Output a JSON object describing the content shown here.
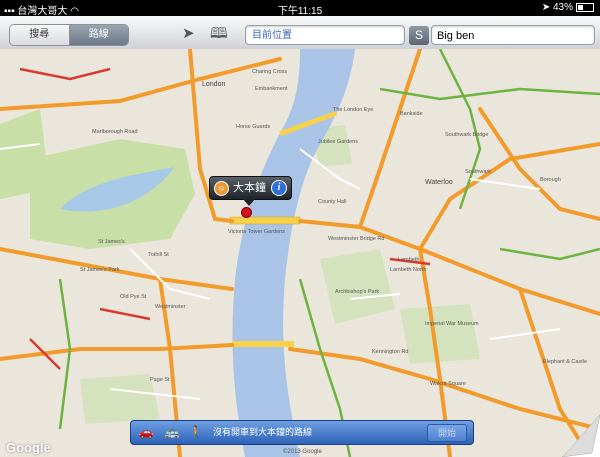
{
  "status_bar": {
    "carrier": "台灣大哥大",
    "time": "下午11:15",
    "battery": "43%"
  },
  "toolbar": {
    "segments": [
      "搜尋",
      "路線"
    ],
    "location_icon": "location-arrow-icon",
    "bookmarks_icon": "bookmarks-icon",
    "start_field": "目前位置",
    "swap_label": "S",
    "end_field": "Big ben"
  },
  "map": {
    "labels": [
      "London",
      "Embankment",
      "Charing Cross",
      "Horse Guards",
      "The London Eye",
      "County Hall",
      "Waterloo",
      "Westminster",
      "St James's",
      "Tothill St",
      "Victoria Tower Gardens",
      "Lambeth North",
      "Southwark",
      "Borough",
      "Old Pye St",
      "Page St",
      "Imperial War Museum",
      "Archbishop's Park",
      "Elephant & Castle",
      "Bankside",
      "Southwark Bridge",
      "Jubilee Gardens",
      "Marlborough Road",
      "St James's Park",
      "Westminster Bridge Rd",
      "Lambeth",
      "Walcot Square",
      "Kennington Rd"
    ]
  },
  "callout": {
    "title": "大本鐘",
    "info_icon": "info-icon"
  },
  "directions": {
    "message": "沒有開車到大本鐘的路線",
    "start_button": "開始"
  },
  "branding": {
    "google": "Google",
    "copyright": "©2013 Google"
  }
}
